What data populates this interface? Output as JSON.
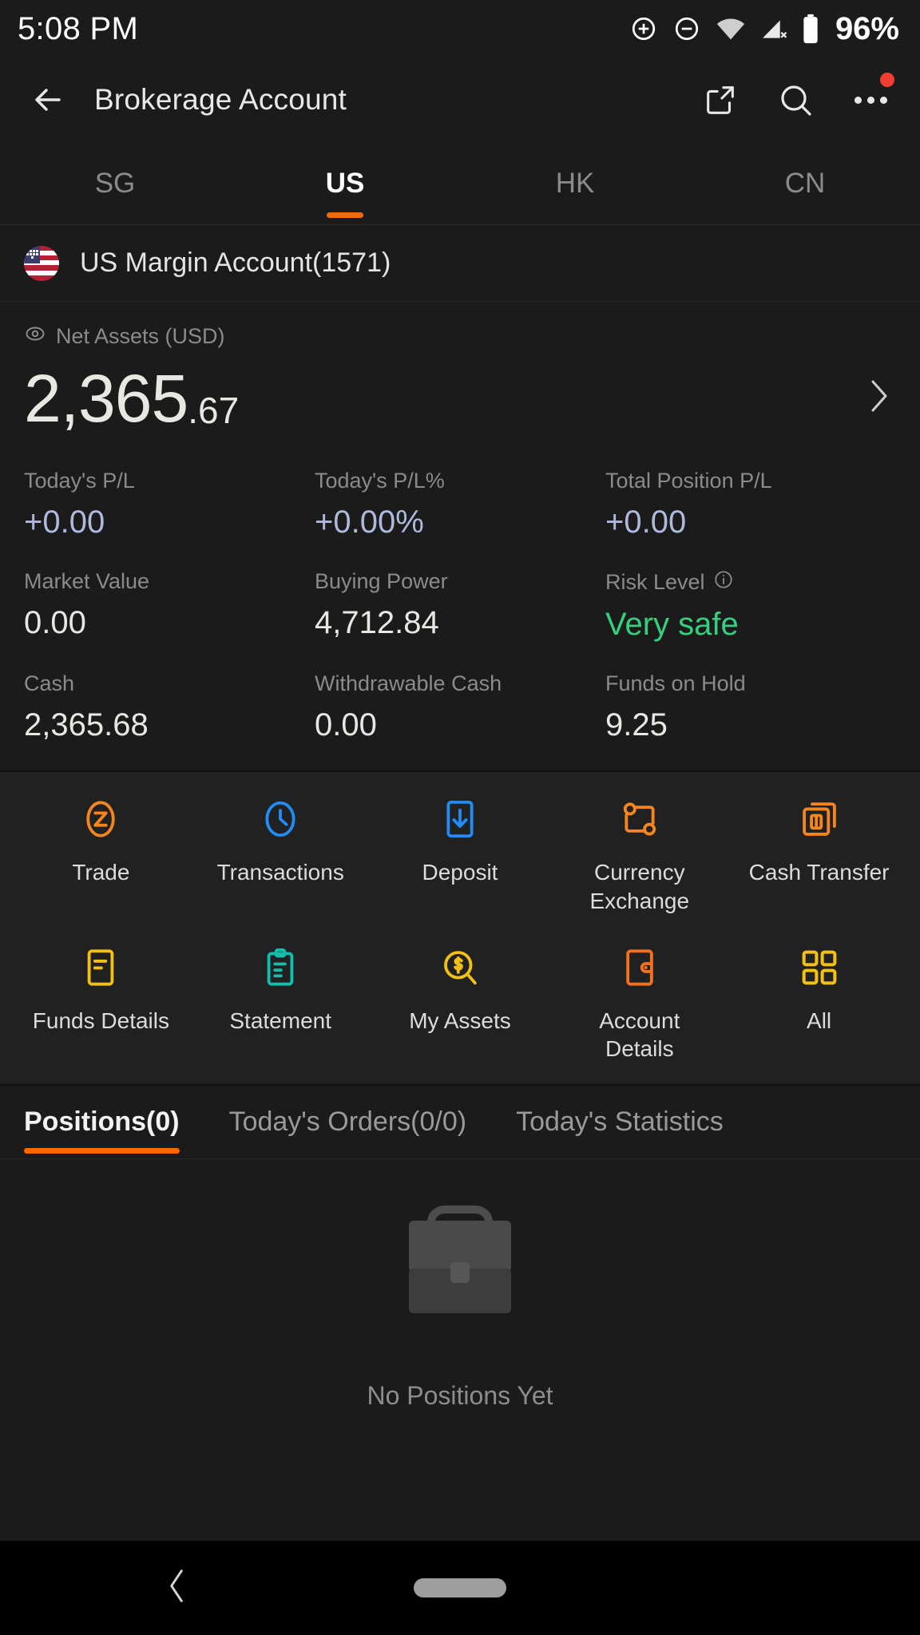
{
  "status_bar": {
    "time": "5:08 PM",
    "battery_percent": "96%",
    "icons": [
      "add-circle-icon",
      "remove-circle-icon",
      "wifi-icon",
      "cellular-off-icon",
      "battery-icon"
    ]
  },
  "app_bar": {
    "back_icon": "arrow-left-icon",
    "title": "Brokerage Account",
    "share_icon": "share-icon",
    "search_icon": "search-icon",
    "more_icon": "more-options-icon",
    "badge": true
  },
  "market_tabs": [
    {
      "label": "SG",
      "active": false
    },
    {
      "label": "US",
      "active": true
    },
    {
      "label": "HK",
      "active": false
    },
    {
      "label": "CN",
      "active": false
    }
  ],
  "account": {
    "flag_icon": "us-flag-icon",
    "name": "US Margin Account(1571)"
  },
  "summary": {
    "net_assets_label": "Net Assets (USD)",
    "eye_icon": "eye-icon",
    "net_assets_integer": "2,365",
    "net_assets_decimal": ".67",
    "chevron_icon": "chevron-right-icon",
    "stats": [
      {
        "label": "Today's P/L",
        "value": "+0.00",
        "style": "pl"
      },
      {
        "label": "Today's P/L%",
        "value": "+0.00%",
        "style": "pl"
      },
      {
        "label": "Total Position P/L",
        "value": "+0.00",
        "style": "pl"
      },
      {
        "label": "Market Value",
        "value": "0.00",
        "style": "plain"
      },
      {
        "label": "Buying Power",
        "value": "4,712.84",
        "style": "plain"
      },
      {
        "label": "Risk Level",
        "value": "Very safe",
        "style": "safe",
        "info_icon": "info-icon"
      },
      {
        "label": "Cash",
        "value": "2,365.68",
        "style": "plain"
      },
      {
        "label": "Withdrawable Cash",
        "value": "0.00",
        "style": "plain"
      },
      {
        "label": "Funds on Hold",
        "value": "9.25",
        "style": "plain"
      }
    ]
  },
  "actions": [
    {
      "label": "Trade",
      "icon": "trade-icon",
      "color": "#f5861f"
    },
    {
      "label": "Transactions",
      "icon": "clock-icon",
      "color": "#1f8df5"
    },
    {
      "label": "Deposit",
      "icon": "deposit-arrow-icon",
      "color": "#1f8df5"
    },
    {
      "label": "Currency Exchange",
      "icon": "currency-exchange-icon",
      "color": "#f5861f"
    },
    {
      "label": "Cash Transfer",
      "icon": "cash-transfer-icon",
      "color": "#f5861f"
    },
    {
      "label": "Funds Details",
      "icon": "funds-details-icon",
      "color": "#f2c017"
    },
    {
      "label": "Statement",
      "icon": "statement-icon",
      "color": "#12bfae"
    },
    {
      "label": "My Assets",
      "icon": "my-assets-icon",
      "color": "#f2c017"
    },
    {
      "label": "Account Details",
      "icon": "wallet-icon",
      "color": "#f5711f"
    },
    {
      "label": "All",
      "icon": "grid-icon",
      "color": "#f2c017"
    }
  ],
  "content_tabs": [
    {
      "label": "Positions(0)",
      "active": true
    },
    {
      "label": "Today's Orders(0/0)",
      "active": false
    },
    {
      "label": "Today's Statistics",
      "active": false
    }
  ],
  "empty_state": {
    "icon": "briefcase-icon",
    "message": "No Positions Yet"
  },
  "nav_bar": {
    "back_icon": "nav-back-icon",
    "home_icon": "nav-home-pill"
  },
  "colors": {
    "accent_orange": "#f56a00",
    "positive_green": "#35d07f",
    "pl_blue": "#aebadb",
    "background": "#1b1b1b"
  }
}
